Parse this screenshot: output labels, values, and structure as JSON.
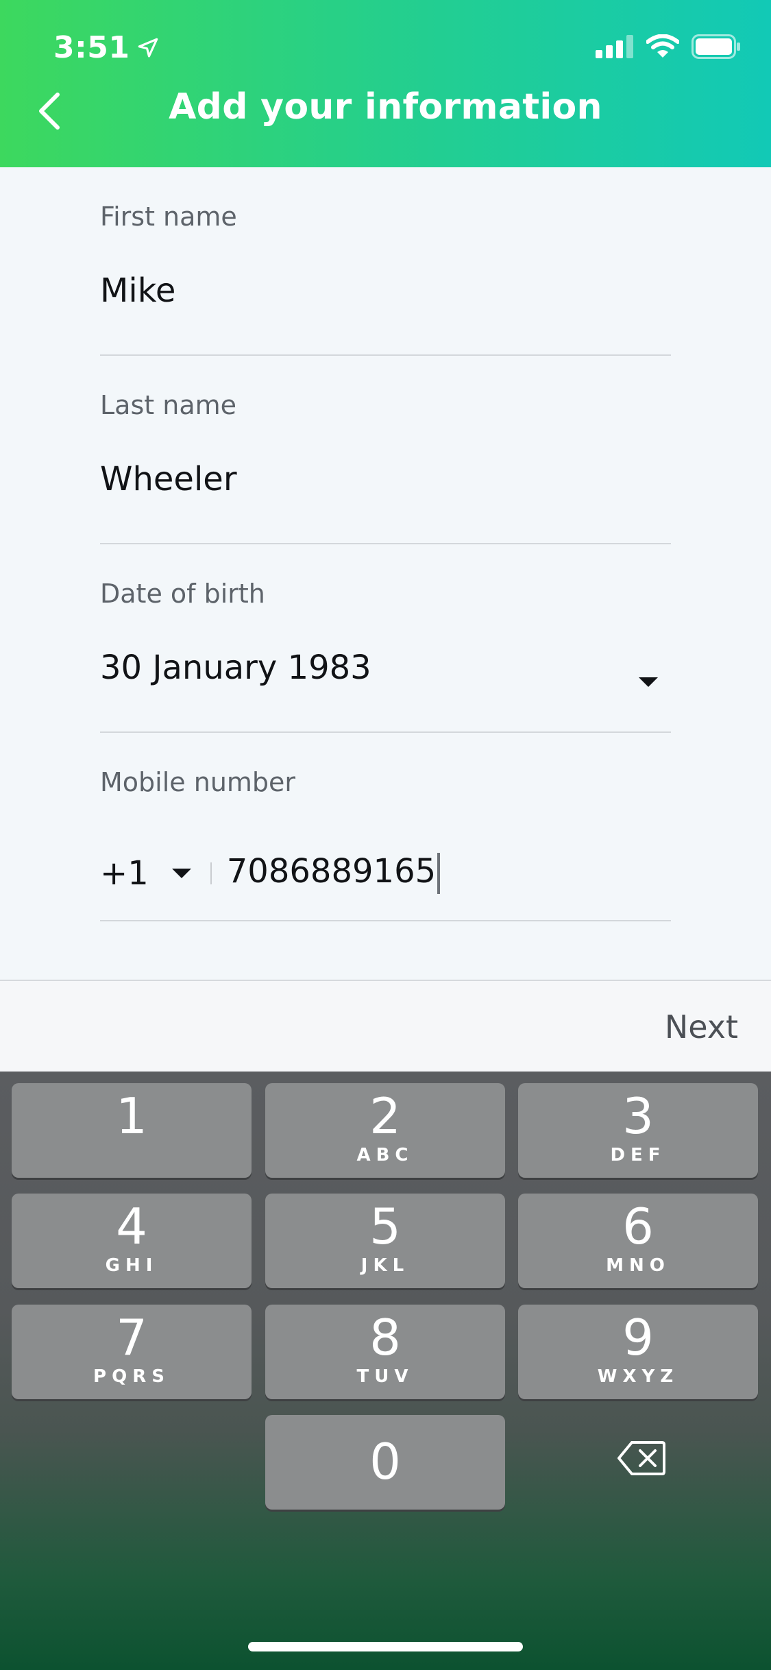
{
  "status_bar": {
    "time": "3:51",
    "icons": [
      "location-arrow-icon",
      "cellular-signal-icon",
      "wifi-icon",
      "battery-icon"
    ]
  },
  "header": {
    "title": "Add your information",
    "back_icon": "chevron-left-icon",
    "gradient_start": "#3dd85e",
    "gradient_end": "#12c9b6"
  },
  "form": {
    "first_name": {
      "label": "First name",
      "value": "Mike"
    },
    "last_name": {
      "label": "Last name",
      "value": "Wheeler"
    },
    "date_of_birth": {
      "label": "Date of birth",
      "value": "30 January 1983"
    },
    "mobile": {
      "label": "Mobile number",
      "country_code": "+1",
      "number": "7086889165"
    }
  },
  "accessory": {
    "next_label": "Next"
  },
  "keypad": {
    "keys": [
      {
        "digit": "1",
        "letters": ""
      },
      {
        "digit": "2",
        "letters": "ABC"
      },
      {
        "digit": "3",
        "letters": "DEF"
      },
      {
        "digit": "4",
        "letters": "GHI"
      },
      {
        "digit": "5",
        "letters": "JKL"
      },
      {
        "digit": "6",
        "letters": "MNO"
      },
      {
        "digit": "7",
        "letters": "PQRS"
      },
      {
        "digit": "8",
        "letters": "TUV"
      },
      {
        "digit": "9",
        "letters": "WXYZ"
      },
      {
        "digit": "0",
        "letters": ""
      }
    ],
    "delete_icon": "backspace-icon"
  }
}
